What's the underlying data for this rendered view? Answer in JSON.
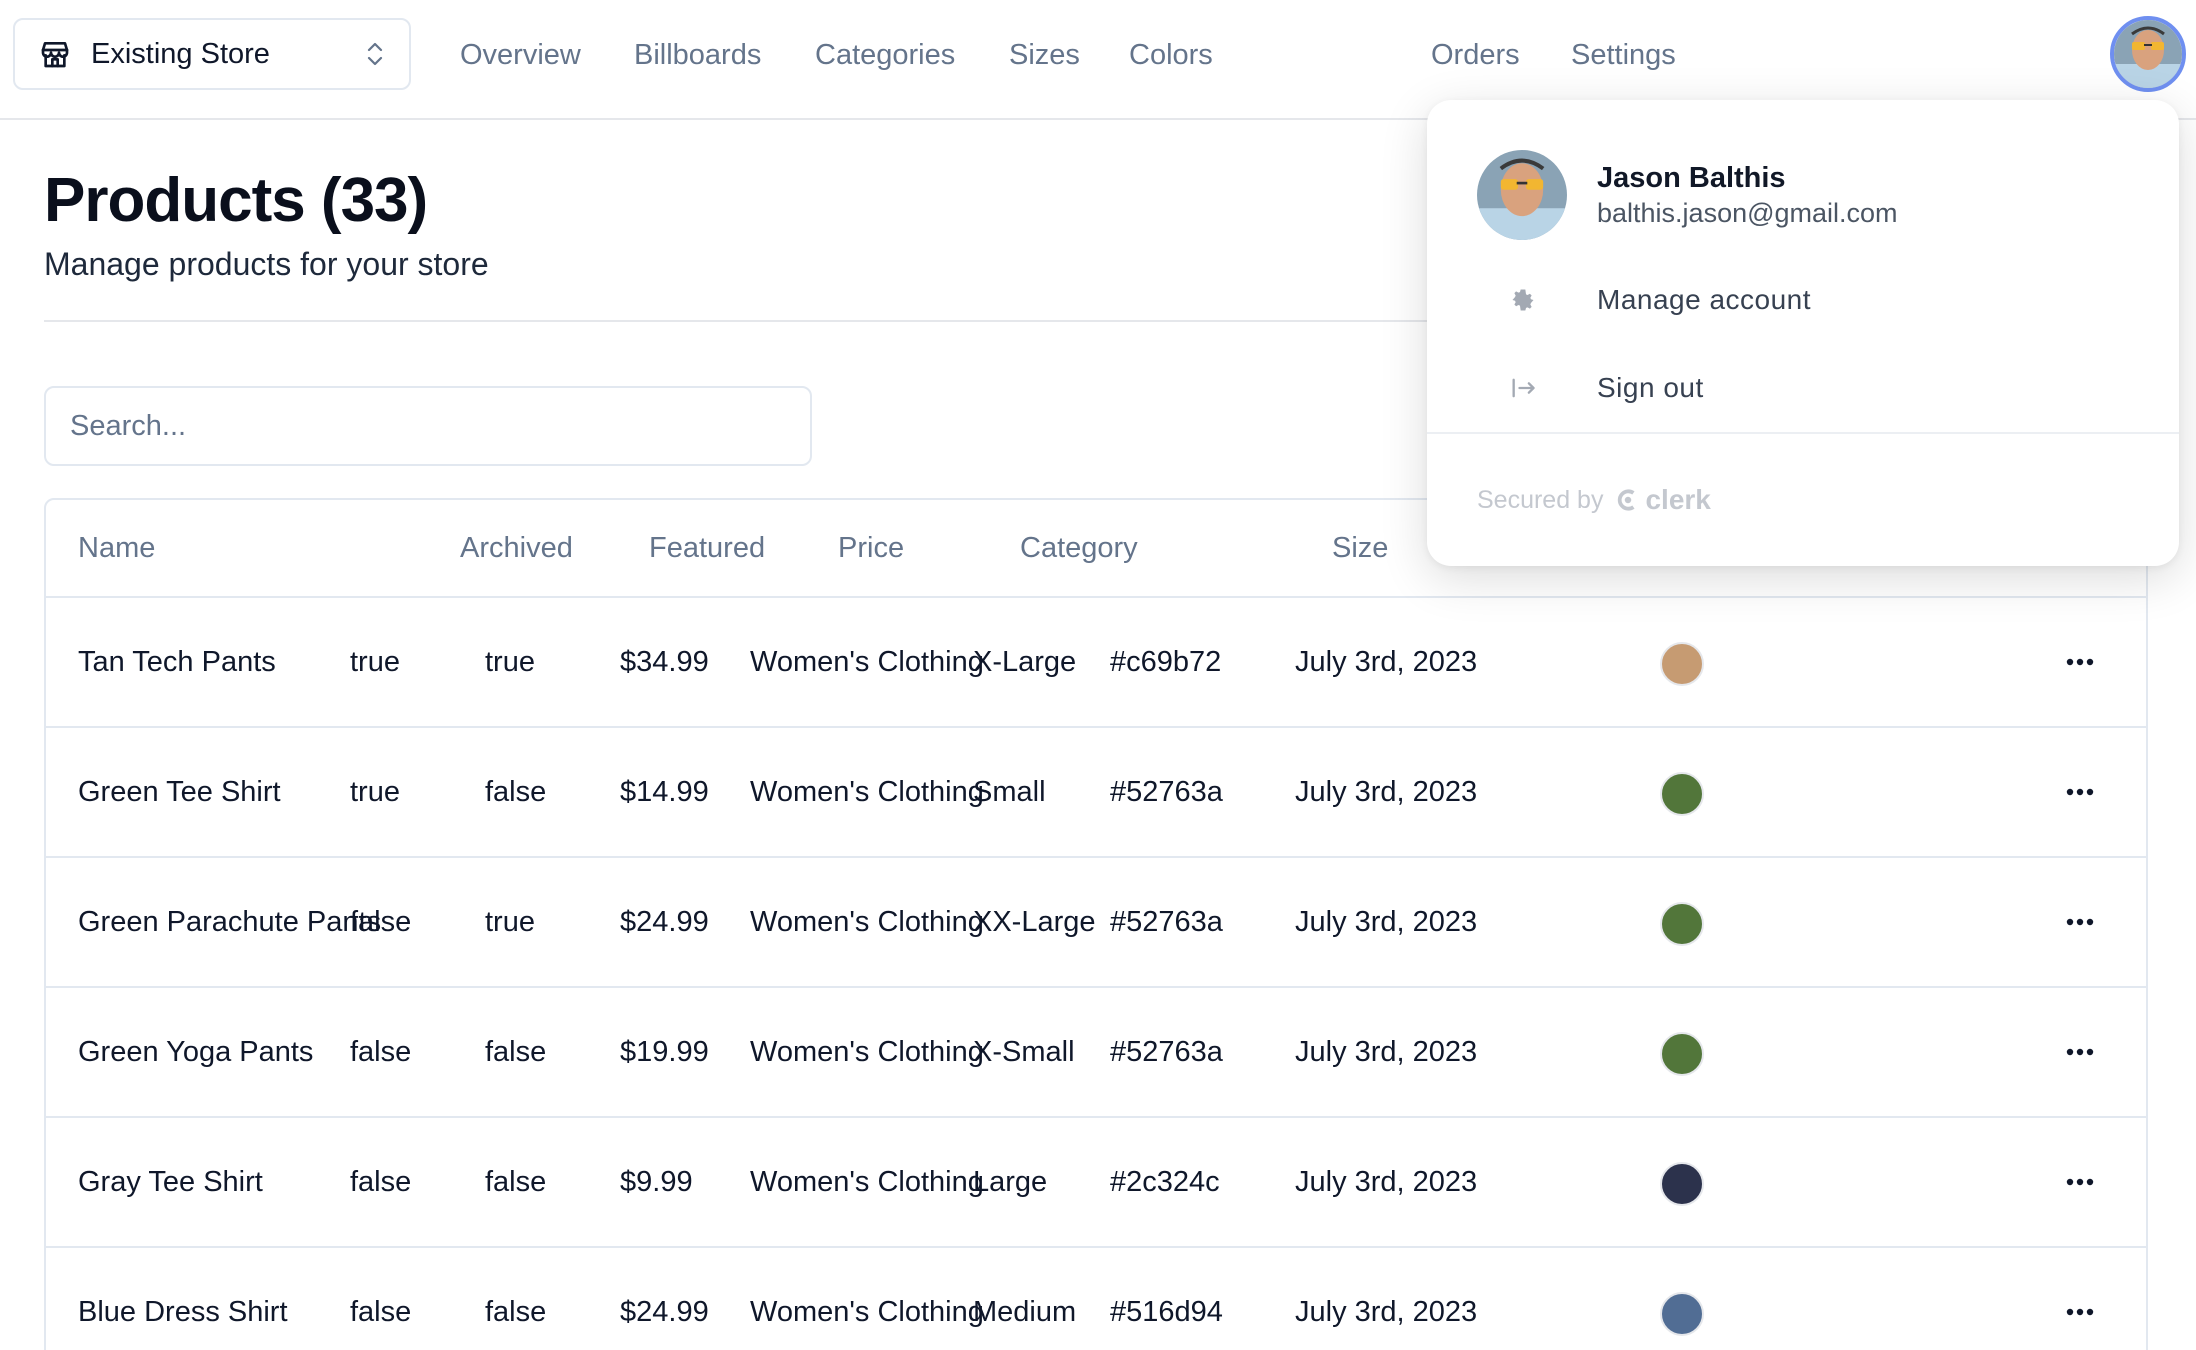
{
  "header": {
    "store_name": "Existing Store",
    "nav": [
      "Overview",
      "Billboards",
      "Categories",
      "Sizes",
      "Colors",
      "Orders",
      "Settings"
    ]
  },
  "page": {
    "title": "Products (33)",
    "subtitle": "Manage products for your store"
  },
  "search": {
    "placeholder": "Search..."
  },
  "table": {
    "columns": [
      "Name",
      "Archived",
      "Featured",
      "Price",
      "Category",
      "Size"
    ],
    "rows": [
      {
        "name": "Tan Tech Pants",
        "archived": "true",
        "featured": "true",
        "price": "$34.99",
        "category": "Women's Clothing",
        "size": "X-Large",
        "color": "#c69b72",
        "date": "July 3rd, 2023"
      },
      {
        "name": "Green Tee Shirt",
        "archived": "true",
        "featured": "false",
        "price": "$14.99",
        "category": "Women's Clothing",
        "size": "Small",
        "color": "#52763a",
        "date": "July 3rd, 2023"
      },
      {
        "name": "Green Parachute Pants",
        "archived": "false",
        "featured": "true",
        "price": "$24.99",
        "category": "Women's Clothing",
        "size": "XX-Large",
        "color": "#52763a",
        "date": "July 3rd, 2023"
      },
      {
        "name": "Green Yoga Pants",
        "archived": "false",
        "featured": "false",
        "price": "$19.99",
        "category": "Women's Clothing",
        "size": "X-Small",
        "color": "#52763a",
        "date": "July 3rd, 2023"
      },
      {
        "name": "Gray Tee Shirt",
        "archived": "false",
        "featured": "false",
        "price": "$9.99",
        "category": "Women's Clothing",
        "size": "Large",
        "color": "#2c324c",
        "date": "July 3rd, 2023"
      },
      {
        "name": "Blue Dress Shirt",
        "archived": "false",
        "featured": "false",
        "price": "$24.99",
        "category": "Women's Clothing",
        "size": "Medium",
        "color": "#516d94",
        "date": "July 3rd, 2023"
      }
    ]
  },
  "user_menu": {
    "name": "Jason Balthis",
    "email": "balthis.jason@gmail.com",
    "items": [
      "Manage account",
      "Sign out"
    ],
    "secured_by": "Secured by",
    "brand": "clerk"
  }
}
